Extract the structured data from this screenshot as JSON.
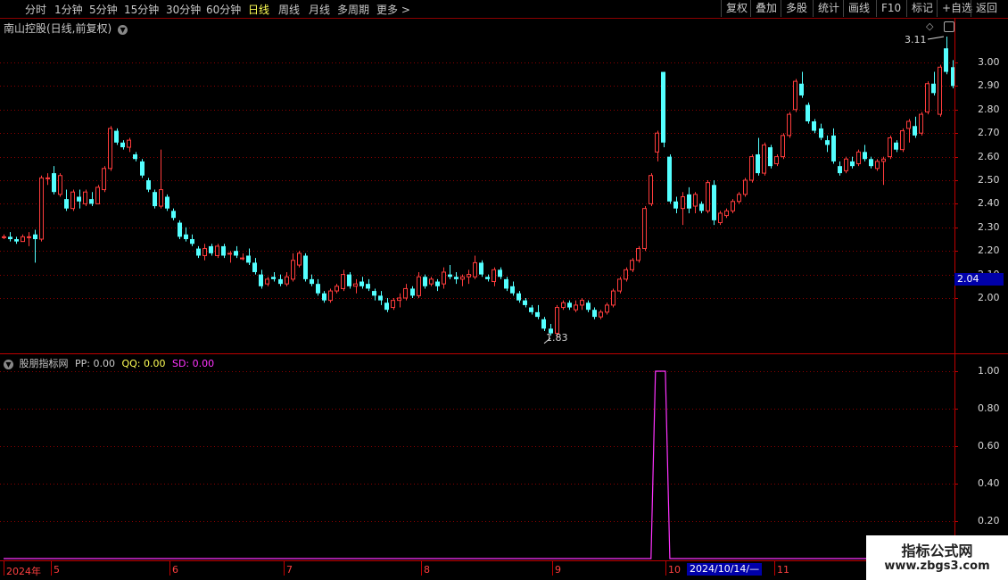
{
  "toolbar": {
    "timeframes": [
      "分时",
      "1分钟",
      "5分钟",
      "15分钟",
      "30分钟",
      "60分钟",
      "日线",
      "周线",
      "月线",
      "多周期",
      "更多 >"
    ],
    "active_timeframe": "日线",
    "buttons": [
      "复权",
      "叠加",
      "多股",
      "统计",
      "画线",
      "F10",
      "标记",
      "+自选",
      "返回"
    ]
  },
  "main_chart": {
    "title": "南山控股(日线,前复权)",
    "price_labels": [
      "3.00",
      "2.90",
      "2.80",
      "2.70",
      "2.60",
      "2.50",
      "2.40",
      "2.30",
      "2.20",
      "2.10",
      "2.00"
    ],
    "current_price": "2.04",
    "high_annotation": "3.11",
    "low_annotation": "1.83"
  },
  "indicator": {
    "name": "股朋指标网",
    "pp": "PP: 0.00",
    "qq": "QQ: 0.00",
    "sd": "SD: 0.00",
    "y_labels": [
      "1.00",
      "0.80",
      "0.60",
      "0.40",
      "0.20"
    ]
  },
  "x_axis": {
    "labels": [
      "2024年",
      "5",
      "6",
      "7",
      "8",
      "9",
      "10",
      "11"
    ],
    "cursor_date": "2024/10/14/—"
  },
  "watermark": {
    "line1": "指标公式网",
    "line2": "www.zbgs3.com"
  },
  "colors": {
    "up": "#ff3c3c",
    "down": "#54ffff",
    "indicator_line": "#ff33ff",
    "grid": "#8b0000",
    "axis": "#c00000"
  },
  "chart_data": {
    "type": "candlestick",
    "price_axis": {
      "min": 2.0,
      "max": 3.0,
      "ticks": [
        2.0,
        2.1,
        2.2,
        2.3,
        2.4,
        2.5,
        2.6,
        2.7,
        2.8,
        2.9,
        3.0
      ]
    },
    "indicator_axis": {
      "min": 0.0,
      "max": 1.0,
      "ticks": [
        0.2,
        0.4,
        0.6,
        0.8,
        1.0
      ]
    },
    "ohlc": [
      [
        2.26,
        2.27,
        2.25,
        2.26
      ],
      [
        2.26,
        2.28,
        2.24,
        2.25
      ],
      [
        2.25,
        2.26,
        2.23,
        2.24
      ],
      [
        2.24,
        2.27,
        2.24,
        2.26
      ],
      [
        2.26,
        2.28,
        2.22,
        2.26
      ],
      [
        2.27,
        2.29,
        2.15,
        2.25
      ],
      [
        2.25,
        2.52,
        2.24,
        2.51
      ],
      [
        2.51,
        2.53,
        2.48,
        2.51
      ],
      [
        2.53,
        2.56,
        2.44,
        2.45
      ],
      [
        2.44,
        2.53,
        2.43,
        2.52
      ],
      [
        2.42,
        2.46,
        2.37,
        2.38
      ],
      [
        2.38,
        2.46,
        2.37,
        2.45
      ],
      [
        2.43,
        2.46,
        2.38,
        2.41
      ],
      [
        2.4,
        2.46,
        2.39,
        2.45
      ],
      [
        2.42,
        2.45,
        2.39,
        2.4
      ],
      [
        2.4,
        2.48,
        2.4,
        2.47
      ],
      [
        2.46,
        2.56,
        2.45,
        2.55
      ],
      [
        2.55,
        2.73,
        2.54,
        2.72
      ],
      [
        2.71,
        2.72,
        2.65,
        2.66
      ],
      [
        2.66,
        2.67,
        2.63,
        2.64
      ],
      [
        2.64,
        2.68,
        2.62,
        2.67
      ],
      [
        2.61,
        2.62,
        2.58,
        2.59
      ],
      [
        2.58,
        2.59,
        2.51,
        2.52
      ],
      [
        2.5,
        2.51,
        2.45,
        2.46
      ],
      [
        2.45,
        2.46,
        2.38,
        2.39
      ],
      [
        2.39,
        2.63,
        2.38,
        2.46
      ],
      [
        2.43,
        2.44,
        2.37,
        2.38
      ],
      [
        2.37,
        2.38,
        2.33,
        2.34
      ],
      [
        2.32,
        2.33,
        2.25,
        2.26
      ],
      [
        2.27,
        2.3,
        2.24,
        2.25
      ],
      [
        2.25,
        2.27,
        2.22,
        2.23
      ],
      [
        2.21,
        2.22,
        2.17,
        2.18
      ],
      [
        2.18,
        2.23,
        2.16,
        2.21
      ],
      [
        2.22,
        2.23,
        2.18,
        2.19
      ],
      [
        2.18,
        2.23,
        2.17,
        2.22
      ],
      [
        2.22,
        2.23,
        2.17,
        2.18
      ],
      [
        2.19,
        2.2,
        2.15,
        2.19
      ],
      [
        2.2,
        2.22,
        2.17,
        2.18
      ],
      [
        2.17,
        2.19,
        2.16,
        2.17
      ],
      [
        2.18,
        2.21,
        2.14,
        2.15
      ],
      [
        2.15,
        2.17,
        2.1,
        2.11
      ],
      [
        2.1,
        2.12,
        2.04,
        2.05
      ],
      [
        2.06,
        2.09,
        2.05,
        2.08
      ],
      [
        2.09,
        2.11,
        2.07,
        2.08
      ],
      [
        2.08,
        2.1,
        2.05,
        2.06
      ],
      [
        2.06,
        2.11,
        2.05,
        2.09
      ],
      [
        2.08,
        2.19,
        2.07,
        2.16
      ],
      [
        2.14,
        2.2,
        2.13,
        2.19
      ],
      [
        2.18,
        2.19,
        2.07,
        2.08
      ],
      [
        2.08,
        2.1,
        2.05,
        2.06
      ],
      [
        2.06,
        2.08,
        2.01,
        2.02
      ],
      [
        2.02,
        2.03,
        1.98,
        1.99
      ],
      [
        1.99,
        2.04,
        1.98,
        2.03
      ],
      [
        2.03,
        2.06,
        2.02,
        2.05
      ],
      [
        2.04,
        2.12,
        2.03,
        2.1
      ],
      [
        2.1,
        2.11,
        2.04,
        2.05
      ],
      [
        2.05,
        2.08,
        2.02,
        2.06
      ],
      [
        2.07,
        2.09,
        2.04,
        2.05
      ],
      [
        2.06,
        2.08,
        2.03,
        2.04
      ],
      [
        2.03,
        2.04,
        1.99,
        2.01
      ],
      [
        2.01,
        2.03,
        1.97,
        1.99
      ],
      [
        1.98,
        2.0,
        1.94,
        1.95
      ],
      [
        1.96,
        2.0,
        1.95,
        1.99
      ],
      [
        1.99,
        2.02,
        1.96,
        2.0
      ],
      [
        2.0,
        2.06,
        1.99,
        2.04
      ],
      [
        2.04,
        2.05,
        2.0,
        2.01
      ],
      [
        2.01,
        2.11,
        2.0,
        2.09
      ],
      [
        2.09,
        2.1,
        2.04,
        2.05
      ],
      [
        2.06,
        2.09,
        2.05,
        2.08
      ],
      [
        2.07,
        2.08,
        2.03,
        2.05
      ],
      [
        2.06,
        2.13,
        2.04,
        2.11
      ],
      [
        2.1,
        2.14,
        2.08,
        2.09
      ],
      [
        2.09,
        2.11,
        2.06,
        2.08
      ],
      [
        2.08,
        2.1,
        2.05,
        2.09
      ],
      [
        2.09,
        2.12,
        2.06,
        2.1
      ],
      [
        2.09,
        2.18,
        2.08,
        2.15
      ],
      [
        2.15,
        2.16,
        2.09,
        2.1
      ],
      [
        2.09,
        2.1,
        2.07,
        2.08
      ],
      [
        2.07,
        2.13,
        2.05,
        2.12
      ],
      [
        2.12,
        2.13,
        2.08,
        2.09
      ],
      [
        2.08,
        2.09,
        2.03,
        2.04
      ],
      [
        2.05,
        2.07,
        2.01,
        2.02
      ],
      [
        2.02,
        2.03,
        1.98,
        1.99
      ],
      [
        1.99,
        2.0,
        1.96,
        1.97
      ],
      [
        1.96,
        1.97,
        1.93,
        1.94
      ],
      [
        1.94,
        1.97,
        1.91,
        1.92
      ],
      [
        1.91,
        1.92,
        1.86,
        1.87
      ],
      [
        1.87,
        1.89,
        1.84,
        1.85
      ],
      [
        1.85,
        1.97,
        1.83,
        1.96
      ],
      [
        1.96,
        1.99,
        1.95,
        1.98
      ],
      [
        1.98,
        1.99,
        1.95,
        1.96
      ],
      [
        1.95,
        1.99,
        1.94,
        1.97
      ],
      [
        1.97,
        2.0,
        1.95,
        1.99
      ],
      [
        1.98,
        1.99,
        1.94,
        1.95
      ],
      [
        1.95,
        1.96,
        1.91,
        1.92
      ],
      [
        1.92,
        1.95,
        1.91,
        1.94
      ],
      [
        1.94,
        1.98,
        1.93,
        1.97
      ],
      [
        1.97,
        2.04,
        1.96,
        2.03
      ],
      [
        2.03,
        2.09,
        2.02,
        2.08
      ],
      [
        2.08,
        2.13,
        2.07,
        2.12
      ],
      [
        2.12,
        2.17,
        2.11,
        2.16
      ],
      [
        2.16,
        2.22,
        2.15,
        2.21
      ],
      [
        2.21,
        2.39,
        2.2,
        2.38
      ],
      [
        2.4,
        2.53,
        2.39,
        2.52
      ],
      [
        2.62,
        2.71,
        2.58,
        2.7
      ],
      [
        2.96,
        2.96,
        2.64,
        2.66
      ],
      [
        2.6,
        2.61,
        2.4,
        2.41
      ],
      [
        2.41,
        2.43,
        2.36,
        2.38
      ],
      [
        2.38,
        2.45,
        2.31,
        2.43
      ],
      [
        2.44,
        2.47,
        2.36,
        2.38
      ],
      [
        2.39,
        2.45,
        2.36,
        2.44
      ],
      [
        2.4,
        2.41,
        2.36,
        2.37
      ],
      [
        2.37,
        2.5,
        2.36,
        2.49
      ],
      [
        2.48,
        2.5,
        2.31,
        2.33
      ],
      [
        2.32,
        2.37,
        2.31,
        2.36
      ],
      [
        2.35,
        2.38,
        2.34,
        2.37
      ],
      [
        2.37,
        2.42,
        2.36,
        2.41
      ],
      [
        2.41,
        2.45,
        2.4,
        2.44
      ],
      [
        2.44,
        2.51,
        2.43,
        2.5
      ],
      [
        2.5,
        2.61,
        2.49,
        2.6
      ],
      [
        2.61,
        2.68,
        2.52,
        2.53
      ],
      [
        2.53,
        2.66,
        2.52,
        2.65
      ],
      [
        2.64,
        2.65,
        2.55,
        2.56
      ],
      [
        2.57,
        2.61,
        2.56,
        2.6
      ],
      [
        2.6,
        2.7,
        2.59,
        2.69
      ],
      [
        2.69,
        2.79,
        2.68,
        2.78
      ],
      [
        2.8,
        2.93,
        2.79,
        2.92
      ],
      [
        2.91,
        2.96,
        2.85,
        2.86
      ],
      [
        2.82,
        2.83,
        2.74,
        2.75
      ],
      [
        2.75,
        2.76,
        2.7,
        2.71
      ],
      [
        2.72,
        2.74,
        2.67,
        2.68
      ],
      [
        2.67,
        2.69,
        2.62,
        2.65
      ],
      [
        2.69,
        2.72,
        2.57,
        2.58
      ],
      [
        2.56,
        2.58,
        2.52,
        2.53
      ],
      [
        2.54,
        2.6,
        2.53,
        2.59
      ],
      [
        2.58,
        2.6,
        2.55,
        2.56
      ],
      [
        2.57,
        2.63,
        2.56,
        2.62
      ],
      [
        2.62,
        2.65,
        2.58,
        2.59
      ],
      [
        2.59,
        2.6,
        2.55,
        2.56
      ],
      [
        2.55,
        2.59,
        2.54,
        2.58
      ],
      [
        2.58,
        2.6,
        2.48,
        2.59
      ],
      [
        2.6,
        2.69,
        2.59,
        2.68
      ],
      [
        2.66,
        2.67,
        2.62,
        2.63
      ],
      [
        2.63,
        2.72,
        2.62,
        2.71
      ],
      [
        2.72,
        2.76,
        2.66,
        2.75
      ],
      [
        2.73,
        2.77,
        2.68,
        2.69
      ],
      [
        2.7,
        2.79,
        2.69,
        2.78
      ],
      [
        2.79,
        2.92,
        2.78,
        2.91
      ],
      [
        2.91,
        2.96,
        2.86,
        2.87
      ],
      [
        2.78,
        2.99,
        2.77,
        2.98
      ],
      [
        3.06,
        3.11,
        2.95,
        2.96
      ],
      [
        2.98,
        3.01,
        2.89,
        2.9
      ]
    ],
    "pp_series": [
      {
        "x_index": 0,
        "value": 0.0
      },
      {
        "x_index": 103,
        "value": 0.0
      },
      {
        "x_index": 104,
        "value": 1.0
      },
      {
        "x_index": 105,
        "value": 1.0
      },
      {
        "x_index": 106,
        "value": 0.0
      },
      {
        "x_index": 151,
        "value": 0.0
      }
    ]
  }
}
